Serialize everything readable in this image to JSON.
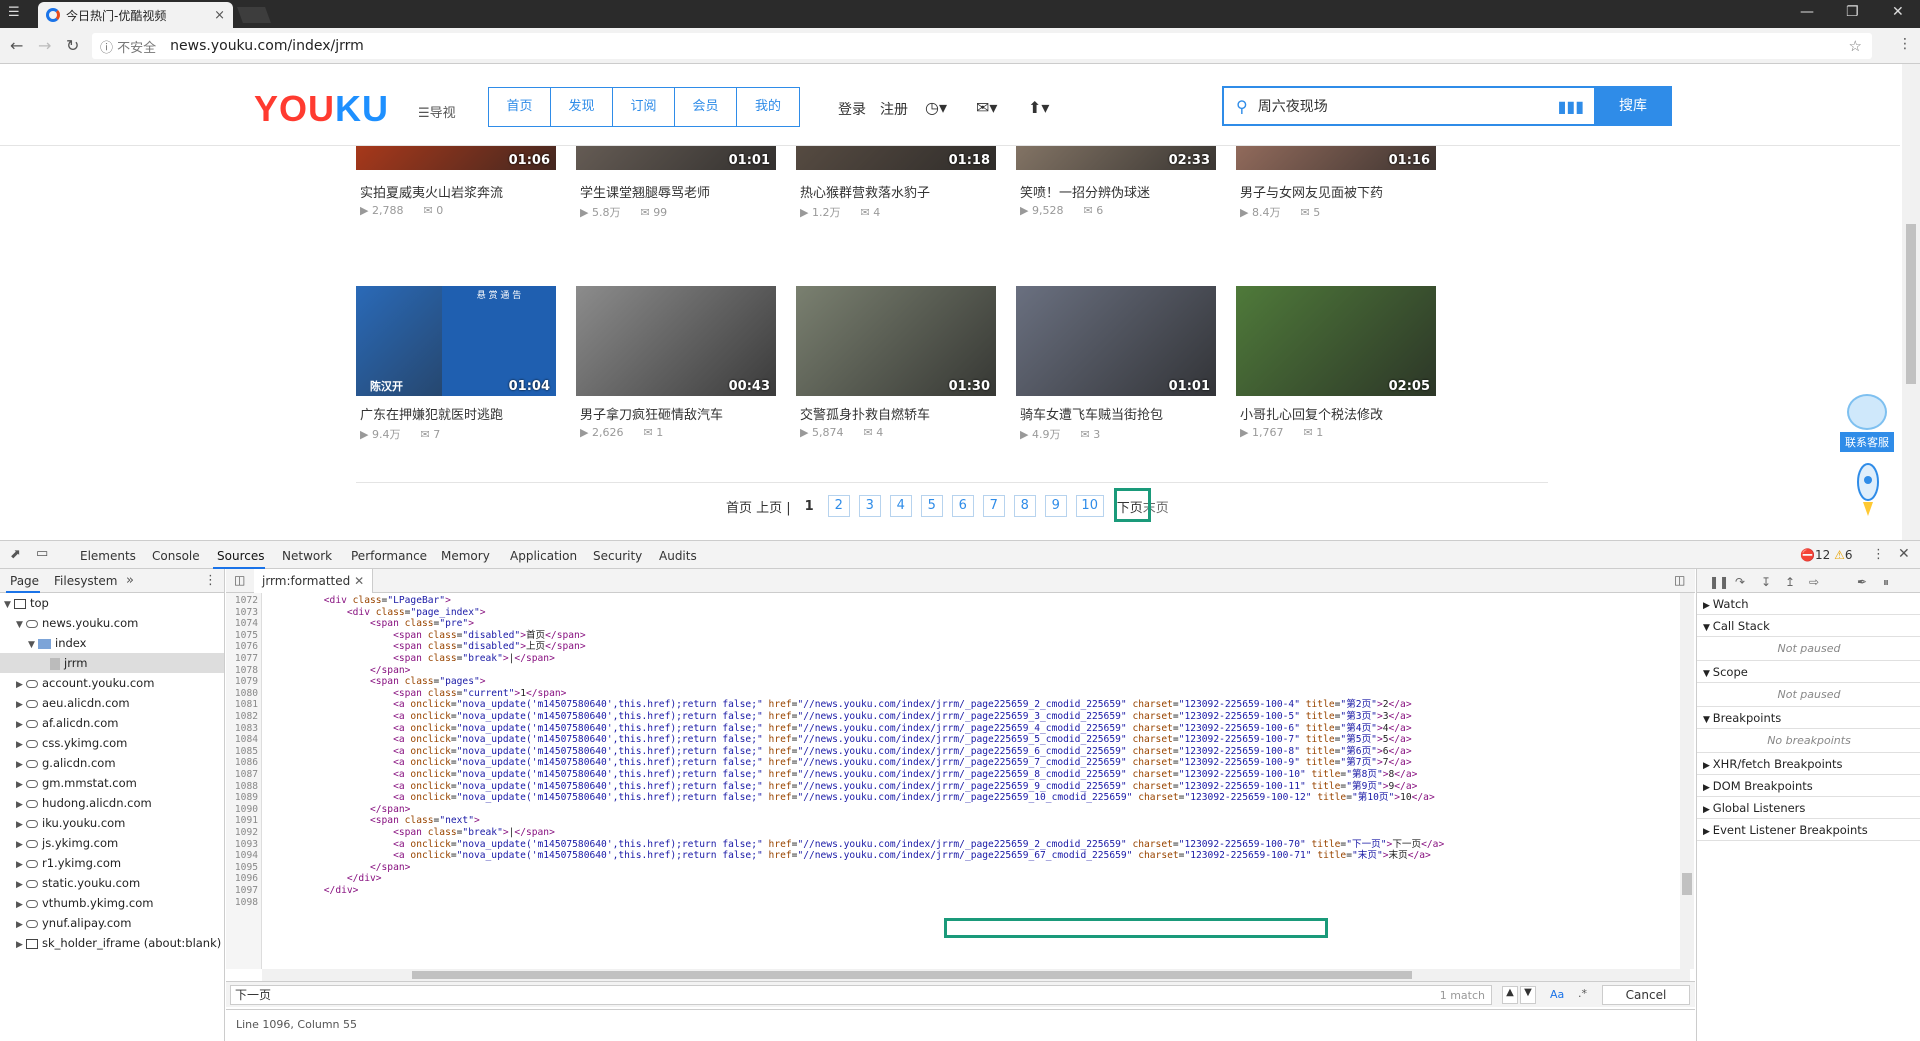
{
  "browser": {
    "tab_title": "今日热门-优酷视频",
    "tab_close": "×",
    "insecure_label": "不安全",
    "url": "news.youku.com/index/jrrm"
  },
  "youku": {
    "logo_a": "YOU",
    "logo_b": "KU",
    "menu_label": "导视",
    "nav_tabs": [
      "首页",
      "发现",
      "订阅",
      "会员",
      "我的"
    ],
    "login": "登录",
    "register": "注册",
    "search_value": "周六夜现场",
    "search_button": "搜库",
    "contact_label": "联系客服"
  },
  "videos": [
    {
      "title": "实拍夏威夷火山岩浆奔流",
      "duration": "01:06",
      "views": "2,788",
      "comments": "0",
      "color": "#b23a1a"
    },
    {
      "title": "学生课堂翘腿辱骂老师",
      "duration": "01:01",
      "views": "5.8万",
      "comments": "99",
      "color": "#6a6058"
    },
    {
      "title": "热心猴群营救落水豹子",
      "duration": "01:18",
      "views": "1.2万",
      "comments": "4",
      "color": "#5a4e44"
    },
    {
      "title": "笑喷！一招分辨伪球迷",
      "duration": "02:33",
      "views": "9,528",
      "comments": "6",
      "color": "#8a7a6a"
    },
    {
      "title": "男子与女网友见面被下药",
      "duration": "01:16",
      "views": "8.4万",
      "comments": "5",
      "color": "#9a7060"
    },
    {
      "title": "广东在押嫌犯就医时逃跑",
      "duration": "01:04",
      "views": "9.4万",
      "comments": "7",
      "color": "#2a6ab8"
    },
    {
      "title": "男子拿刀疯狂砸情敌汽车",
      "duration": "00:43",
      "views": "2,626",
      "comments": "1",
      "color": "#8c8c8c"
    },
    {
      "title": "交警孤身扑救自燃轿车",
      "duration": "01:30",
      "views": "5,874",
      "comments": "4",
      "color": "#7a8070"
    },
    {
      "title": "骑车女遭飞车贼当街抢包",
      "duration": "01:01",
      "views": "4.9万",
      "comments": "3",
      "color": "#6a7080"
    },
    {
      "title": "小哥扎心回复个税法修改",
      "duration": "02:05",
      "views": "1,767",
      "comments": "1",
      "color": "#4f7a3a"
    }
  ],
  "poster_header": "悬 赏 通 告",
  "poster_name": "陈汉开",
  "pager": {
    "first_prev": "首页 上页 |",
    "current": "1",
    "pages": [
      "2",
      "3",
      "4",
      "5",
      "6",
      "7",
      "8",
      "9",
      "10"
    ],
    "next": "下页",
    "last": "末页"
  },
  "devtools": {
    "tabs": [
      "Elements",
      "Console",
      "Sources",
      "Network",
      "Performance",
      "Memory",
      "Application",
      "Security",
      "Audits"
    ],
    "errors": "12",
    "warnings": "6",
    "left_tabs": [
      "Page",
      "Filesystem"
    ],
    "open_file": "jrrm:formatted",
    "tree": [
      {
        "label": "top",
        "indent": 0,
        "kind": "frame",
        "open": true
      },
      {
        "label": "news.youku.com",
        "indent": 1,
        "kind": "cloud",
        "open": true
      },
      {
        "label": "index",
        "indent": 2,
        "kind": "folder",
        "open": true
      },
      {
        "label": "jrrm",
        "indent": 3,
        "kind": "file",
        "open": false,
        "selected": true
      },
      {
        "label": "account.youku.com",
        "indent": 1,
        "kind": "cloud",
        "open": false
      },
      {
        "label": "aeu.alicdn.com",
        "indent": 1,
        "kind": "cloud",
        "open": false
      },
      {
        "label": "af.alicdn.com",
        "indent": 1,
        "kind": "cloud",
        "open": false
      },
      {
        "label": "css.ykimg.com",
        "indent": 1,
        "kind": "cloud",
        "open": false
      },
      {
        "label": "g.alicdn.com",
        "indent": 1,
        "kind": "cloud",
        "open": false
      },
      {
        "label": "gm.mmstat.com",
        "indent": 1,
        "kind": "cloud",
        "open": false
      },
      {
        "label": "hudong.alicdn.com",
        "indent": 1,
        "kind": "cloud",
        "open": false
      },
      {
        "label": "iku.youku.com",
        "indent": 1,
        "kind": "cloud",
        "open": false
      },
      {
        "label": "js.ykimg.com",
        "indent": 1,
        "kind": "cloud",
        "open": false
      },
      {
        "label": "r1.ykimg.com",
        "indent": 1,
        "kind": "cloud",
        "open": false
      },
      {
        "label": "static.youku.com",
        "indent": 1,
        "kind": "cloud",
        "open": false
      },
      {
        "label": "vthumb.ykimg.com",
        "indent": 1,
        "kind": "cloud",
        "open": false
      },
      {
        "label": "ynuf.alipay.com",
        "indent": 1,
        "kind": "cloud",
        "open": false
      },
      {
        "label": "sk_holder_iframe (about:blank)",
        "indent": 1,
        "kind": "frame",
        "open": false
      }
    ],
    "code_lines": [
      {
        "n": "1072",
        "t": "          <div class=\"LPageBar\">"
      },
      {
        "n": "1073",
        "t": "              <div class=\"page_index\">"
      },
      {
        "n": "1074",
        "t": "                  <span class=\"pre\">"
      },
      {
        "n": "1075",
        "t": "                      <span class=\"disabled\">首页</span>"
      },
      {
        "n": "1076",
        "t": "                      <span class=\"disabled\">上页</span>"
      },
      {
        "n": "1077",
        "t": "                      <span class=\"break\">|</span>"
      },
      {
        "n": "1078",
        "t": "                  </span>"
      },
      {
        "n": "1079",
        "t": "                  <span class=\"pages\">"
      },
      {
        "n": "1080",
        "t": "                      <span class=\"current\">1</span>"
      },
      {
        "n": "1081",
        "t": "                      <a onclick=\"nova_update('m14507580640',this.href);return false;\" href=\"//news.youku.com/index/jrrm/_page225659_2_cmodid_225659\" charset=\"123092-225659-100-4\" title=\"第2页\">2</a>"
      },
      {
        "n": "1082",
        "t": "                      <a onclick=\"nova_update('m14507580640',this.href);return false;\" href=\"//news.youku.com/index/jrrm/_page225659_3_cmodid_225659\" charset=\"123092-225659-100-5\" title=\"第3页\">3</a>"
      },
      {
        "n": "1083",
        "t": "                      <a onclick=\"nova_update('m14507580640',this.href);return false;\" href=\"//news.youku.com/index/jrrm/_page225659_4_cmodid_225659\" charset=\"123092-225659-100-6\" title=\"第4页\">4</a>"
      },
      {
        "n": "1084",
        "t": "                      <a onclick=\"nova_update('m14507580640',this.href);return false;\" href=\"//news.youku.com/index/jrrm/_page225659_5_cmodid_225659\" charset=\"123092-225659-100-7\" title=\"第5页\">5</a>"
      },
      {
        "n": "1085",
        "t": "                      <a onclick=\"nova_update('m14507580640',this.href);return false;\" href=\"//news.youku.com/index/jrrm/_page225659_6_cmodid_225659\" charset=\"123092-225659-100-8\" title=\"第6页\">6</a>"
      },
      {
        "n": "1086",
        "t": "                      <a onclick=\"nova_update('m14507580640',this.href);return false;\" href=\"//news.youku.com/index/jrrm/_page225659_7_cmodid_225659\" charset=\"123092-225659-100-9\" title=\"第7页\">7</a>"
      },
      {
        "n": "1087",
        "t": "                      <a onclick=\"nova_update('m14507580640',this.href);return false;\" href=\"//news.youku.com/index/jrrm/_page225659_8_cmodid_225659\" charset=\"123092-225659-100-10\" title=\"第8页\">8</a>"
      },
      {
        "n": "1088",
        "t": "                      <a onclick=\"nova_update('m14507580640',this.href);return false;\" href=\"//news.youku.com/index/jrrm/_page225659_9_cmodid_225659\" charset=\"123092-225659-100-11\" title=\"第9页\">9</a>"
      },
      {
        "n": "1089",
        "t": "                      <a onclick=\"nova_update('m14507580640',this.href);return false;\" href=\"//news.youku.com/index/jrrm/_page225659_10_cmodid_225659\" charset=\"123092-225659-100-12\" title=\"第10页\">10</a>"
      },
      {
        "n": "1090",
        "t": "                  </span>"
      },
      {
        "n": "1091",
        "t": "                  <span class=\"next\">"
      },
      {
        "n": "1092",
        "t": "                      <span class=\"break\">|</span>"
      },
      {
        "n": "1093",
        "t": "                      <a onclick=\"nova_update('m14507580640',this.href);return false;\" href=\"//news.youku.com/index/jrrm/_page225659_2_cmodid_225659\" charset=\"123092-225659-100-70\" title=\"下一页\">下一页</a>"
      },
      {
        "n": "1094",
        "t": "                      <a onclick=\"nova_update('m14507580640',this.href);return false;\" href=\"//news.youku.com/index/jrrm/_page225659_67_cmodid_225659\" charset=\"123092-225659-100-71\" title=\"末页\">末页</a>"
      },
      {
        "n": "1095",
        "t": "                  </span>"
      },
      {
        "n": "1096",
        "t": "              </div>"
      },
      {
        "n": "1097",
        "t": "          </div>"
      },
      {
        "n": "1098",
        "t": ""
      }
    ],
    "find_query": "下一页",
    "find_count": "1 match",
    "case_label": "Aa",
    "regex_label": ".*",
    "cancel": "Cancel",
    "status": "Line 1096, Column 55",
    "right_sections": [
      {
        "label": "Watch",
        "open": false,
        "note": ""
      },
      {
        "label": "Call Stack",
        "open": true,
        "note": "Not paused"
      },
      {
        "label": "Scope",
        "open": true,
        "note": "Not paused"
      },
      {
        "label": "Breakpoints",
        "open": true,
        "note": "No breakpoints"
      },
      {
        "label": "XHR/fetch Breakpoints",
        "open": false,
        "note": ""
      },
      {
        "label": "DOM Breakpoints",
        "open": false,
        "note": ""
      },
      {
        "label": "Global Listeners",
        "open": false,
        "note": ""
      },
      {
        "label": "Event Listener Breakpoints",
        "open": false,
        "note": ""
      }
    ]
  }
}
